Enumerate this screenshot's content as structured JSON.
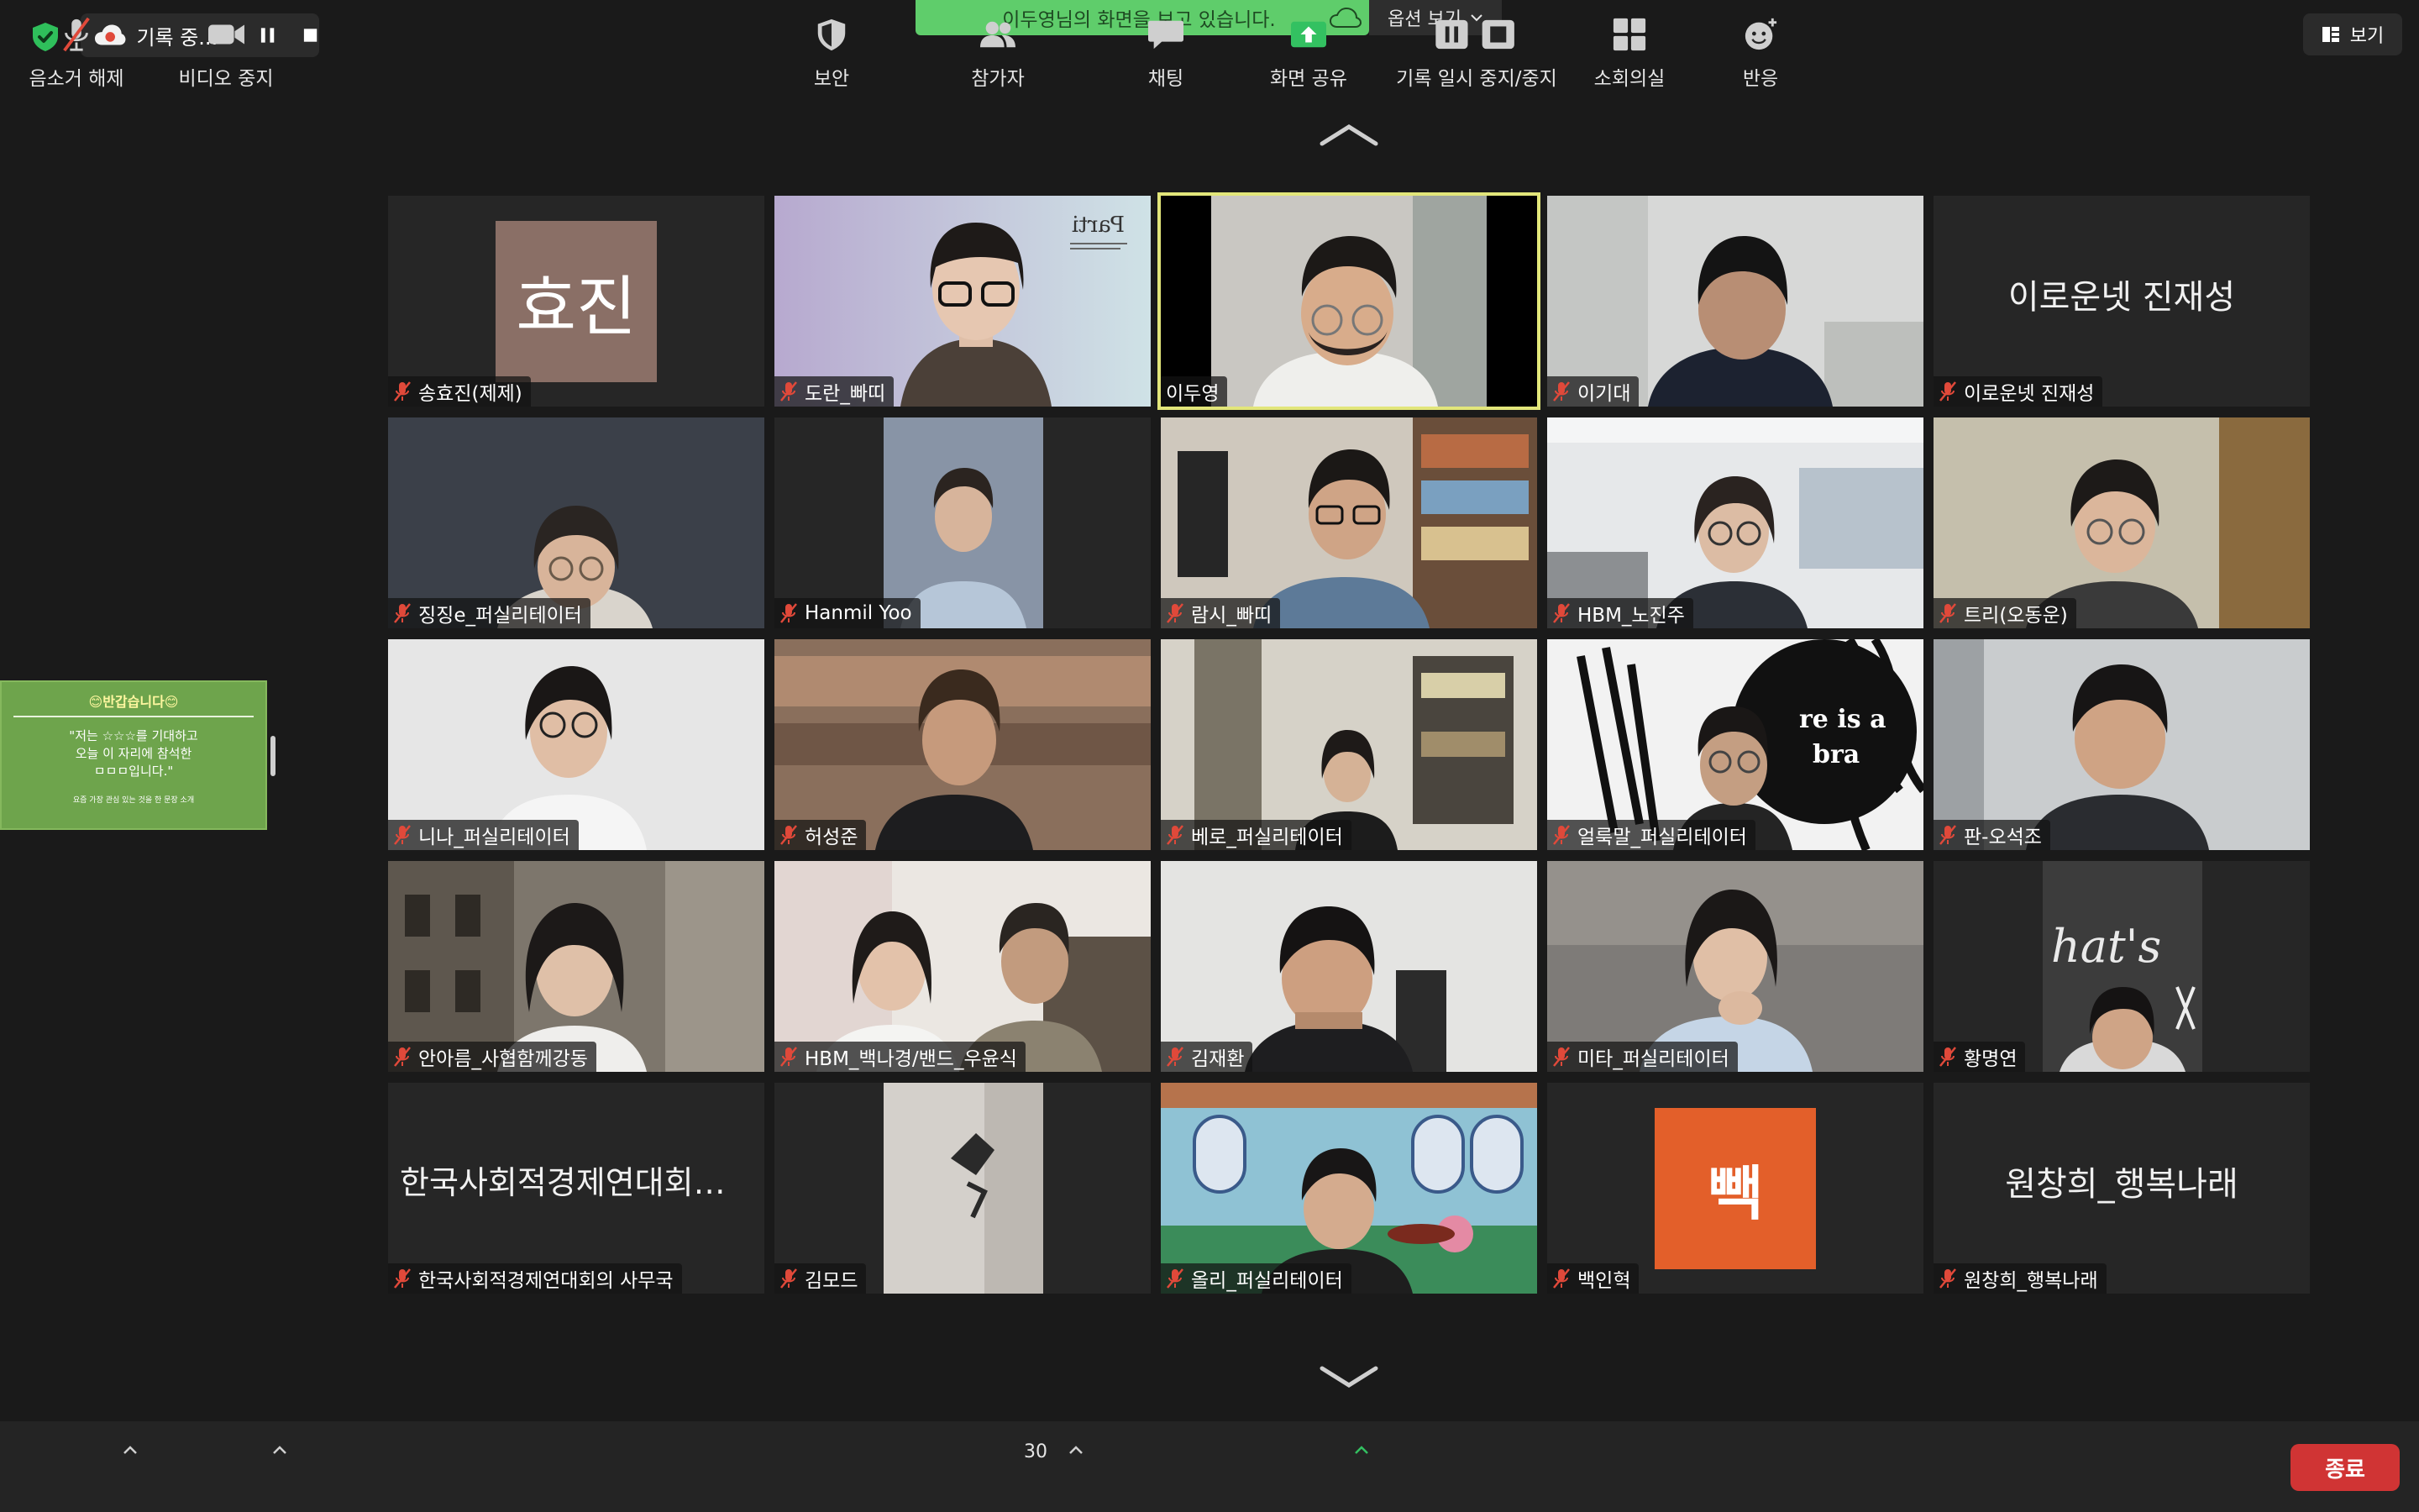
{
  "top_bar": {
    "recording_label": "기록 중...",
    "share_banner_text": "이두영님의 화면을 보고 있습니다.",
    "options_label": "옵션 보기",
    "view_label": "보기"
  },
  "side_card": {
    "title": "😊반갑습니다😊",
    "body_line1": "\"저는 ☆☆☆를 기대하고",
    "body_line2": "오늘 이 자리에 참석한",
    "body_line3": "ㅁㅁㅁ입니다.\"",
    "footer": "요즘 가장 관심 있는 것을 한 문장 소개"
  },
  "tiles": [
    {
      "name": "송효진(제제)",
      "avatar_text": "효진"
    },
    {
      "name": "도란_빠띠",
      "scene_text": "Parti"
    },
    {
      "name": "이두영"
    },
    {
      "name": "이기대"
    },
    {
      "name": "이로운넷 진재성",
      "center_name": "이로운넷 진재성"
    },
    {
      "name": "징징e_퍼실리테이터"
    },
    {
      "name": "Hanmil Yoo"
    },
    {
      "name": "람시_빠띠"
    },
    {
      "name": "HBM_노진주"
    },
    {
      "name": "트리(오동운)"
    },
    {
      "name": "니나_퍼실리테이터"
    },
    {
      "name": "허성준"
    },
    {
      "name": "베로_퍼실리테이터"
    },
    {
      "name": "얼룩말_퍼실리테이터",
      "scene_text1": "re is a",
      "scene_text2": "bra"
    },
    {
      "name": "판-오석조"
    },
    {
      "name": "안아름_사협함께강동"
    },
    {
      "name": "HBM_백나경/밴드_우윤식"
    },
    {
      "name": "김재환"
    },
    {
      "name": "미타_퍼실리테이터"
    },
    {
      "name": "황명연",
      "scene_text": "hat's"
    },
    {
      "name": "한국사회적경제연대회의 사무국",
      "center_name": "한국사회적경제연대회의..."
    },
    {
      "name": "김모드"
    },
    {
      "name": "올리_퍼실리테이터"
    },
    {
      "name": "백인혁",
      "avatar_text": "빽"
    },
    {
      "name": "원창희_행복나래",
      "center_name": "원창희_행복나래"
    }
  ],
  "toolbar": {
    "unmute_label": "음소거 해제",
    "stop_video_label": "비디오 중지",
    "security_label": "보안",
    "participants_label": "참가자",
    "participants_count": "30",
    "chat_label": "채팅",
    "share_label": "화면 공유",
    "record_label": "기록 일시 중지/중지",
    "breakout_label": "소회의실",
    "reactions_label": "반응",
    "end_label": "종료"
  },
  "colors": {
    "background": "#1a1a1a",
    "tile_background": "#262626",
    "active_speaker_border": "#e2e67a",
    "share_banner": "#5fcd6b",
    "share_icon": "#33c161",
    "end_button": "#d03434",
    "mute_icon": "#e0493a",
    "side_card": "#6ea44c",
    "avatar_hyojin": "#8a6f66",
    "avatar_baek": "#e35f2a"
  }
}
